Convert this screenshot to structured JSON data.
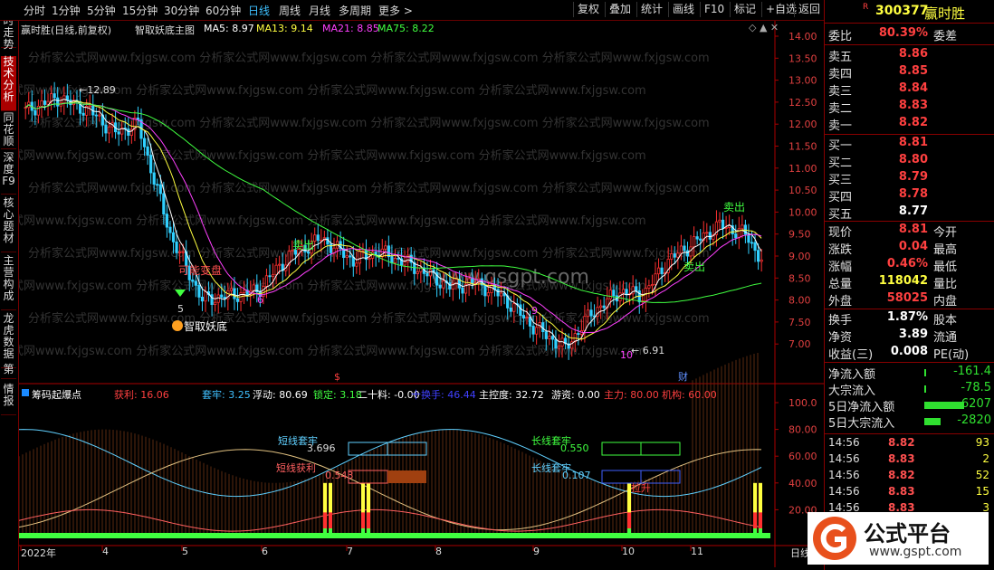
{
  "toolbar": {
    "periods": [
      "分时",
      "1分钟",
      "5分钟",
      "15分钟",
      "30分钟",
      "60分钟",
      "日线",
      "周线",
      "月线",
      "多周期",
      "更多 >"
    ],
    "active_period": "日线",
    "right_buttons": [
      "复权",
      "叠加",
      "统计",
      "画线",
      "F10",
      "标记",
      "+自选",
      "返回"
    ]
  },
  "side_tabs": [
    "分时走势",
    "技术分析",
    "同花顺",
    "深度F9",
    "核心题材",
    "主营构成",
    "龙虎数据",
    "第",
    "情报"
  ],
  "main_chart": {
    "title": "赢时胜(日线,前复权)",
    "indicator": "智取妖底主图",
    "ma5": "MA5: 8.97",
    "ma13": "MA13: 9.14",
    "ma21": "MA21: 8.85",
    "ma75": "MA75: 8.22",
    "y_ticks": [
      "14.00",
      "13.50",
      "13.00",
      "12.50",
      "12.00",
      "11.50",
      "11.00",
      "10.50",
      "10.00",
      "9.50",
      "9.00",
      "8.50",
      "8.00",
      "7.50",
      "7.00"
    ],
    "high_label": "12.89",
    "low_label": "6.91",
    "annotations": [
      "可能变盘",
      "智取妖底",
      "卖出",
      "卖出",
      "卖出"
    ],
    "numbers": [
      "5",
      "6",
      "9",
      "10"
    ],
    "watermark_url": "www.gsgpt.com",
    "watermark_text": "分析家公式网www.fxjgsw.com",
    "cai_label": "财",
    "s_label": "$"
  },
  "sub_chart": {
    "title": "筹码起爆点",
    "items": [
      {
        "label": "获利: 16.06",
        "color": "#ff4040"
      },
      {
        "label": "套牢: 3.25",
        "color": "#40c0ff"
      },
      {
        "label": "浮动: 80.69",
        "color": "#ffffff"
      },
      {
        "label": "锁定: 3.18",
        "color": "#40ff40"
      },
      {
        "label": "二十料: -0.00",
        "color": "#ffffff"
      },
      {
        "label": "十换手: 46.44",
        "color": "#4040ff"
      },
      {
        "label": "主控度: 32.72",
        "color": "#ffffff"
      },
      {
        "label": "游资: 0.00",
        "color": "#ffffff"
      },
      {
        "label": "主力: 80.00",
        "color": "#ff4040"
      },
      {
        "label": "机构: 60.00",
        "color": "#ff4040"
      }
    ],
    "y_ticks": [
      "100.0",
      "80.00",
      "60.00",
      "40.00",
      "20.00"
    ],
    "labels": {
      "short_hold": "短线套牢",
      "short_hold_val": "3.696",
      "short_profit": "短线获利",
      "short_profit_val": "0.543",
      "long_hold": "长线套牢",
      "long_hold_val": "0.550",
      "long_chip": "长线套牢",
      "long_chip_val": "0.107",
      "pull_label": "拉升"
    },
    "x_labels": [
      "2022年",
      "4",
      "5",
      "6",
      "7",
      "8",
      "9",
      "10",
      "11"
    ],
    "right_label": "日线"
  },
  "panel": {
    "code": "300377",
    "name": "赢时胜",
    "r_badge": "R",
    "webi_label": "委比",
    "webi": "80.39%",
    "webi2": "委差",
    "sells": [
      {
        "k": "卖五",
        "v": "8.86"
      },
      {
        "k": "卖四",
        "v": "8.85"
      },
      {
        "k": "卖三",
        "v": "8.84"
      },
      {
        "k": "卖二",
        "v": "8.83"
      },
      {
        "k": "卖一",
        "v": "8.82"
      }
    ],
    "buys": [
      {
        "k": "买一",
        "v": "8.81"
      },
      {
        "k": "买二",
        "v": "8.80"
      },
      {
        "k": "买三",
        "v": "8.79"
      },
      {
        "k": "买四",
        "v": "8.78"
      },
      {
        "k": "买五",
        "v": "8.77"
      }
    ],
    "stats": [
      {
        "k": "现价",
        "v": "8.81",
        "c": "red",
        "k2": "今开"
      },
      {
        "k": "涨跌",
        "v": "0.04",
        "c": "red",
        "k2": "最高"
      },
      {
        "k": "涨幅",
        "v": "0.46%",
        "c": "red",
        "k2": "最低"
      },
      {
        "k": "总量",
        "v": "118042",
        "c": "yel",
        "k2": "量比"
      },
      {
        "k": "外盘",
        "v": "58025",
        "c": "red",
        "k2": "内盘"
      }
    ],
    "stats2": [
      {
        "k": "换手",
        "v": "1.87%",
        "c": "wht",
        "k2": "股本"
      },
      {
        "k": "净资",
        "v": "3.89",
        "c": "wht",
        "k2": "流通"
      },
      {
        "k": "收益(三)",
        "v": "0.008",
        "c": "wht",
        "k2": "PE(动)"
      }
    ],
    "flows": [
      {
        "k": "净流入额",
        "v": "-161.4",
        "bar": 0
      },
      {
        "k": "大宗流入",
        "v": "-78.5",
        "bar": 0
      },
      {
        "k": "5日净流入额",
        "v": "-6207",
        "bar": 1
      },
      {
        "k": "5日大宗流入",
        "v": "-2820",
        "bar": 0.4
      }
    ],
    "ticks": [
      {
        "t": "14:56",
        "p": "8.82",
        "q": "93"
      },
      {
        "t": "14:56",
        "p": "8.83",
        "q": "2"
      },
      {
        "t": "14:56",
        "p": "8.82",
        "q": "52"
      },
      {
        "t": "14:56",
        "p": "8.83",
        "q": "15"
      },
      {
        "t": "14:56",
        "p": "8.83",
        "q": "3"
      }
    ]
  },
  "logo": {
    "text": "公式平台",
    "url": "www.gspt.com"
  }
}
